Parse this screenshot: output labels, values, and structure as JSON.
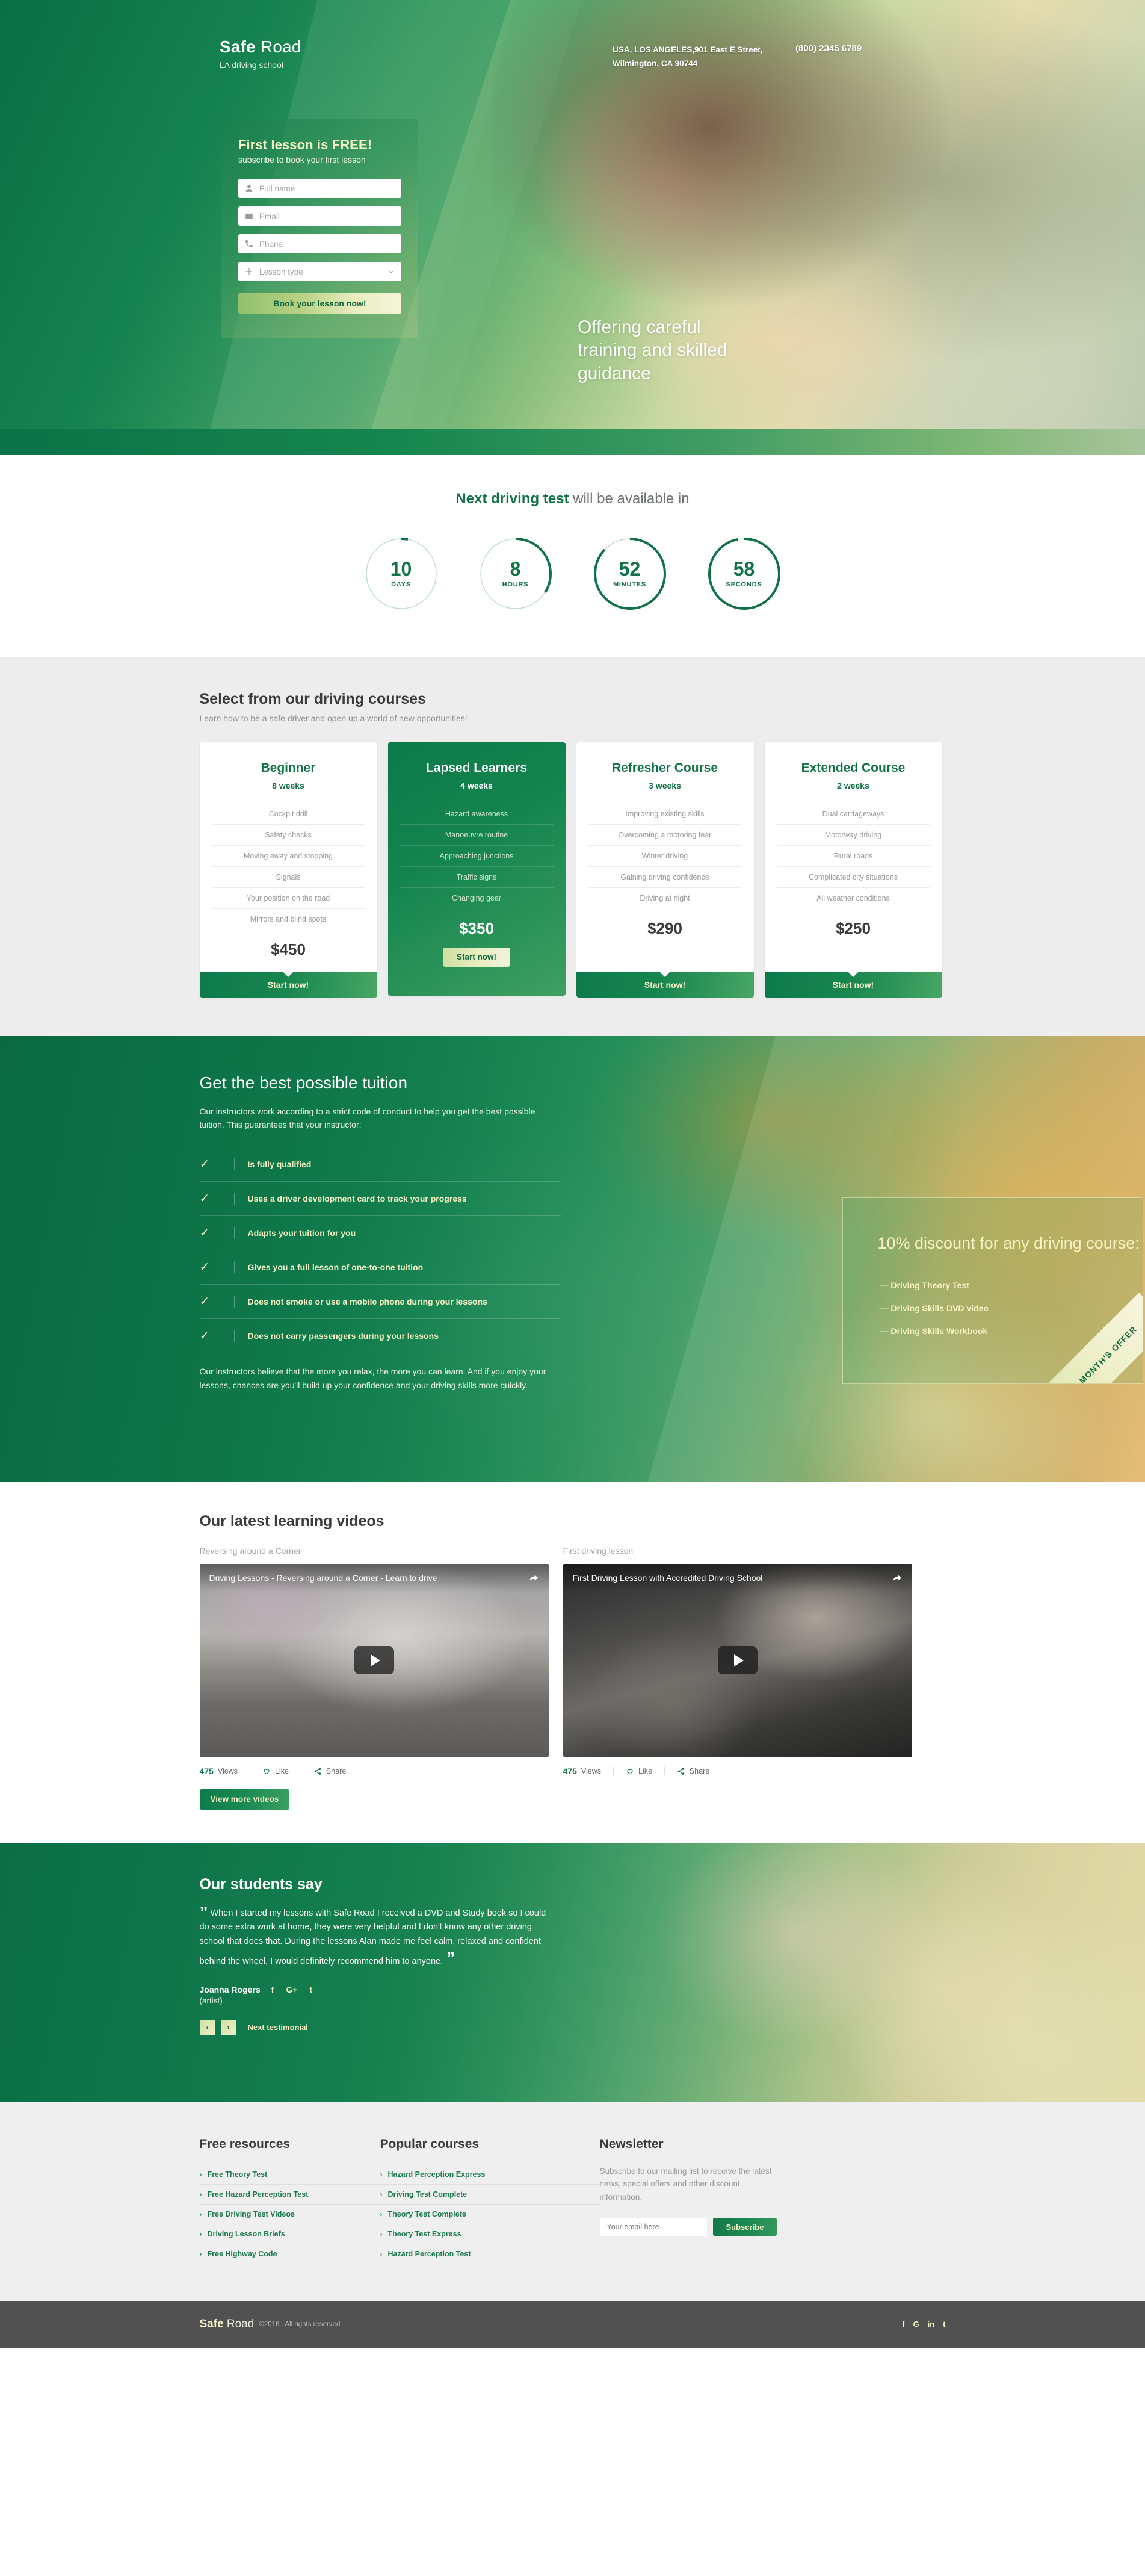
{
  "brand": {
    "name_bold": "Safe",
    "name_light": " Road",
    "tagline": "LA driving school"
  },
  "header": {
    "address_line1": "USA, LOS ANGELES,901 East E Street,",
    "address_line2": "Wilmington, CA 90744",
    "phone": "(800) 2345 6789"
  },
  "hero": {
    "form_title": "First lesson is FREE!",
    "form_subtitle": "subscribe to book your first lesson",
    "fields": [
      {
        "icon": "user-icon",
        "placeholder": "Full name",
        "value": ""
      },
      {
        "icon": "email-icon",
        "placeholder": "Email",
        "value": ""
      },
      {
        "icon": "phone-icon",
        "placeholder": "Phone",
        "value": ""
      },
      {
        "icon": "plus-icon",
        "placeholder": "Lesson type",
        "value": ""
      }
    ],
    "submit_label": "Book your lesson now!",
    "tagline": "Offering careful training and skilled guidance"
  },
  "countdown": {
    "title_bold": "Next driving test",
    "title_rest": " will be available in",
    "units": [
      {
        "value": "10",
        "label": "DAYS",
        "percent": 3
      },
      {
        "value": "8",
        "label": "HOURS",
        "percent": 34
      },
      {
        "value": "52",
        "label": "MINUTES",
        "percent": 87
      },
      {
        "value": "58",
        "label": "SECONDS",
        "percent": 97
      }
    ]
  },
  "courses": {
    "heading": "Select from our driving courses",
    "subheading": "Learn how to be a safe driver and open up a world of new opportunities!",
    "cta_label": "Start now!",
    "items": [
      {
        "name": "Beginner",
        "duration": "8 weeks",
        "features": [
          "Cockpit drill",
          "Safety checks",
          "Moving away and stopping",
          "Signals",
          "Your position on the road",
          "Mirrors and blind spots"
        ],
        "price": "$450",
        "featured": false
      },
      {
        "name": "Lapsed Learners",
        "duration": "4 weeks",
        "features": [
          "Hazard awareness",
          "Manoeuvre routine",
          "Approaching junctions",
          "Traffic signs",
          "Changing gear"
        ],
        "price": "$350",
        "featured": true
      },
      {
        "name": "Refresher Course",
        "duration": "3 weeks",
        "features": [
          "Improving existing skills",
          "Overcoming a motoring fear",
          "Winter driving",
          "Gaining driving confidence",
          "Driving at night"
        ],
        "price": "$290",
        "featured": false
      },
      {
        "name": "Extended Course",
        "duration": "2 weeks",
        "features": [
          "Dual carriageways",
          "Motorway driving",
          "Rural roads",
          "Complicated city situations",
          "All weather conditions"
        ],
        "price": "$250",
        "featured": false
      }
    ]
  },
  "tuition": {
    "heading": "Get the best possible tuition",
    "intro": "Our instructors work according to a strict code of conduct to help you get the best possible tuition. This guarantees that your instructor:",
    "checklist": [
      "Is fully qualified",
      "Uses a driver development card to track your progress",
      "Adapts your tuition for you",
      "Gives you a full lesson of one-to-one tuition",
      "Does not smoke or use a mobile phone during your lessons",
      "Does not carry passengers during your lessons"
    ],
    "footer_text": "Our instructors believe that the more you relax, the more you can learn. And if you enjoy your lessons, chances are you'll build up your confidence and your driving skills more quickly.",
    "offer": {
      "title": "10% discount for any driving course:",
      "items": [
        "— Driving Theory Test",
        "— Driving Skills DVD video",
        "— Driving Skills Workbook"
      ],
      "ribbon": "THIS MONTH'S OFFER"
    }
  },
  "videos": {
    "heading": "Our latest learning videos",
    "more_label": "View more videos",
    "items": [
      {
        "caption": "Reversing around a Corner",
        "overlay_title": "Driving Lessons - Reversing around a Corner - Learn to drive",
        "views_count": "475",
        "views_label": "Views",
        "like_label": "Like",
        "share_label": "Share"
      },
      {
        "caption": "First driving lesson",
        "overlay_title": "First Driving Lesson with Accredited Driving School",
        "views_count": "475",
        "views_label": "Views",
        "like_label": "Like",
        "share_label": "Share"
      }
    ]
  },
  "testimonials": {
    "heading": "Our students say",
    "quote": "When I started my lessons with Safe Road I received a DVD and Study book so I could do some extra work at home, they were very helpful and I don't know any other driving school that does that. During the lessons Alan made me feel calm, relaxed and confident behind the wheel, I would definitely recommend him to anyone.",
    "author": "Joanna Rogers",
    "role": "(artist)",
    "socials": [
      "f",
      "G+",
      "t"
    ],
    "prev_label": "‹",
    "next_label": "›",
    "next_testimonial_label": "Next testimonial"
  },
  "footer": {
    "col1": {
      "heading": "Free resources",
      "items": [
        "Free Theory Test",
        "Free Hazard Perception Test",
        "Free Driving Test Videos",
        "Driving Lesson Briefs",
        "Free Highway Code"
      ]
    },
    "col2": {
      "heading": "Popular courses",
      "items": [
        "Hazard Perception Express",
        "Driving Test Complete",
        "Theory Test Complete",
        "Theory Test Express",
        "Hazard Perception Test"
      ]
    },
    "newsletter": {
      "heading": "Newsletter",
      "description": "Subscribe to our mailing list to receive the latest news, special offers and other discount information.",
      "input_placeholder": "Your email here",
      "input_value": "",
      "button_label": "Subscribe"
    },
    "bottom": {
      "brand_bold": "Safe",
      "brand_light": " Road",
      "copyright": "©2016 . All rights reserved",
      "socials": [
        "f",
        "G",
        "in",
        "t"
      ]
    }
  },
  "colors": {
    "primary_green": "#127247",
    "accent_cream": "#f6f2c4",
    "dark_text": "#3b3b3b",
    "muted_text": "#9a9a9a"
  }
}
